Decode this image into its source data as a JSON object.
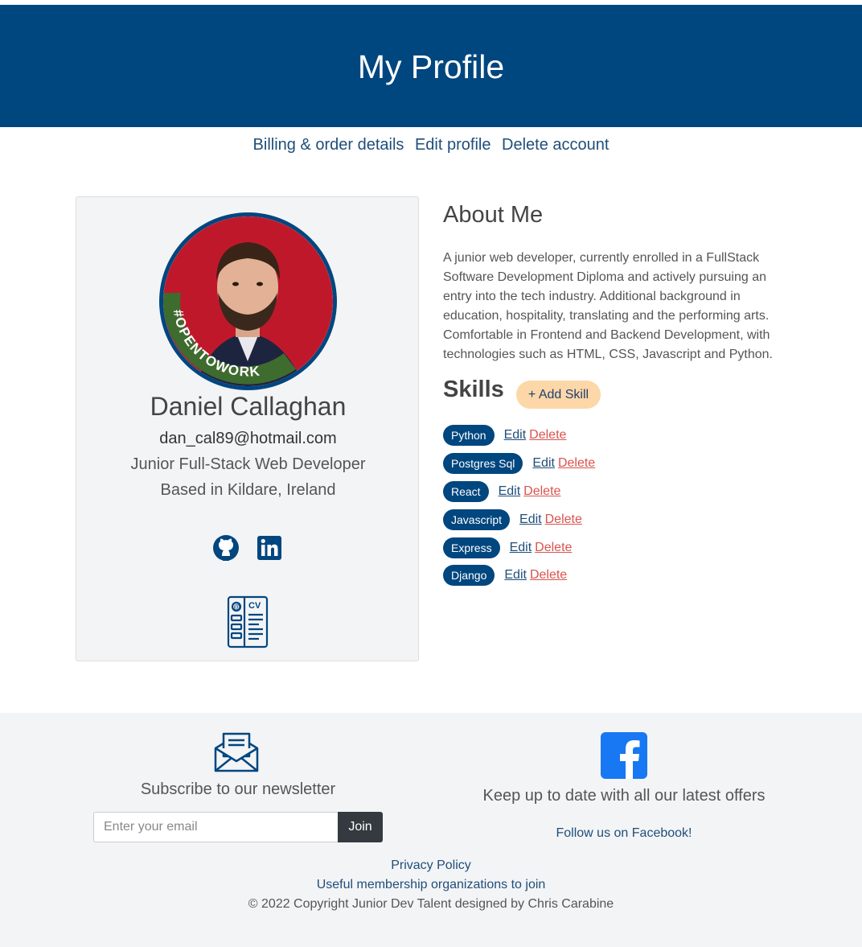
{
  "header": {
    "title": "My Profile"
  },
  "subnav": [
    {
      "label": "Billing & order details"
    },
    {
      "label": "Edit profile"
    },
    {
      "label": "Delete account"
    }
  ],
  "profile": {
    "name": "Daniel Callaghan",
    "email": "dan_cal89@hotmail.com",
    "role": "Junior Full-Stack Web Developer",
    "location": "Based in Kildare, Ireland",
    "badge_text": "#OPENTOWORK",
    "icons": [
      "github-icon",
      "linkedin-icon",
      "cv-icon"
    ],
    "brand_color": "#00467f"
  },
  "about": {
    "title": "About Me",
    "text": "A junior web developer, currently enrolled in a FullStack Software Development Diploma and actively pursuing an entry into the tech industry. Additional background in education, hospitality, translating and the performing arts. Comfortable in Frontend and Backend Development, with technologies such as HTML, CSS, Javascript and Python."
  },
  "skills": {
    "title": "Skills",
    "add_label": "+ Add Skill",
    "edit_label": "Edit",
    "delete_label": "Delete",
    "items": [
      "Python",
      "Postgres Sql",
      "React",
      "Javascript",
      "Express",
      "Django"
    ]
  },
  "footer": {
    "newsletter_title": "Subscribe to our newsletter",
    "email_placeholder": "Enter your email",
    "join_label": "Join",
    "facebook_title": "Keep up to date with all our latest offers",
    "facebook_link": "Follow us on Facebook!",
    "privacy": "Privacy Policy",
    "memberships": "Useful membership organizations to join",
    "copyright": "© 2022 Copyright Junior Dev Talent designed by Chris Carabine"
  }
}
